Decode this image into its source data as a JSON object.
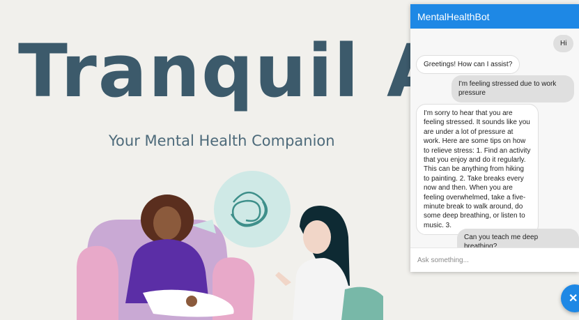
{
  "hero": {
    "title": "Tranquil AI",
    "subtitle": "Your Mental Health Companion"
  },
  "chat": {
    "title": "MentalHealthBot",
    "messages": [
      {
        "role": "user",
        "text": "Hi"
      },
      {
        "role": "bot",
        "text": "Greetings! How can I assist?"
      },
      {
        "role": "user",
        "text": "I'm feeling stressed due to work pressure"
      },
      {
        "role": "bot",
        "text": "I'm sorry to hear that you are feeling stressed. It sounds like you are under a lot of pressure at work. Here are some tips on how to relieve stress: 1. Find an activity that you enjoy and do it regularly. This can be anything from hiking to painting. 2. Take breaks every now and then. When you are feeling overwhelmed, take a five-minute break to walk around, do some deep breathing, or listen to music. 3."
      },
      {
        "role": "user",
        "text": "Can you teach me deep breathing?"
      }
    ],
    "input_placeholder": "Ask something...",
    "close_icon": "close-icon",
    "colors": {
      "header": "#1e88e5",
      "user_bubble": "#dfdfdf",
      "bot_bubble": "#ffffff"
    }
  },
  "colors": {
    "background": "#f1f0ec",
    "title": "#3c5a6b"
  }
}
